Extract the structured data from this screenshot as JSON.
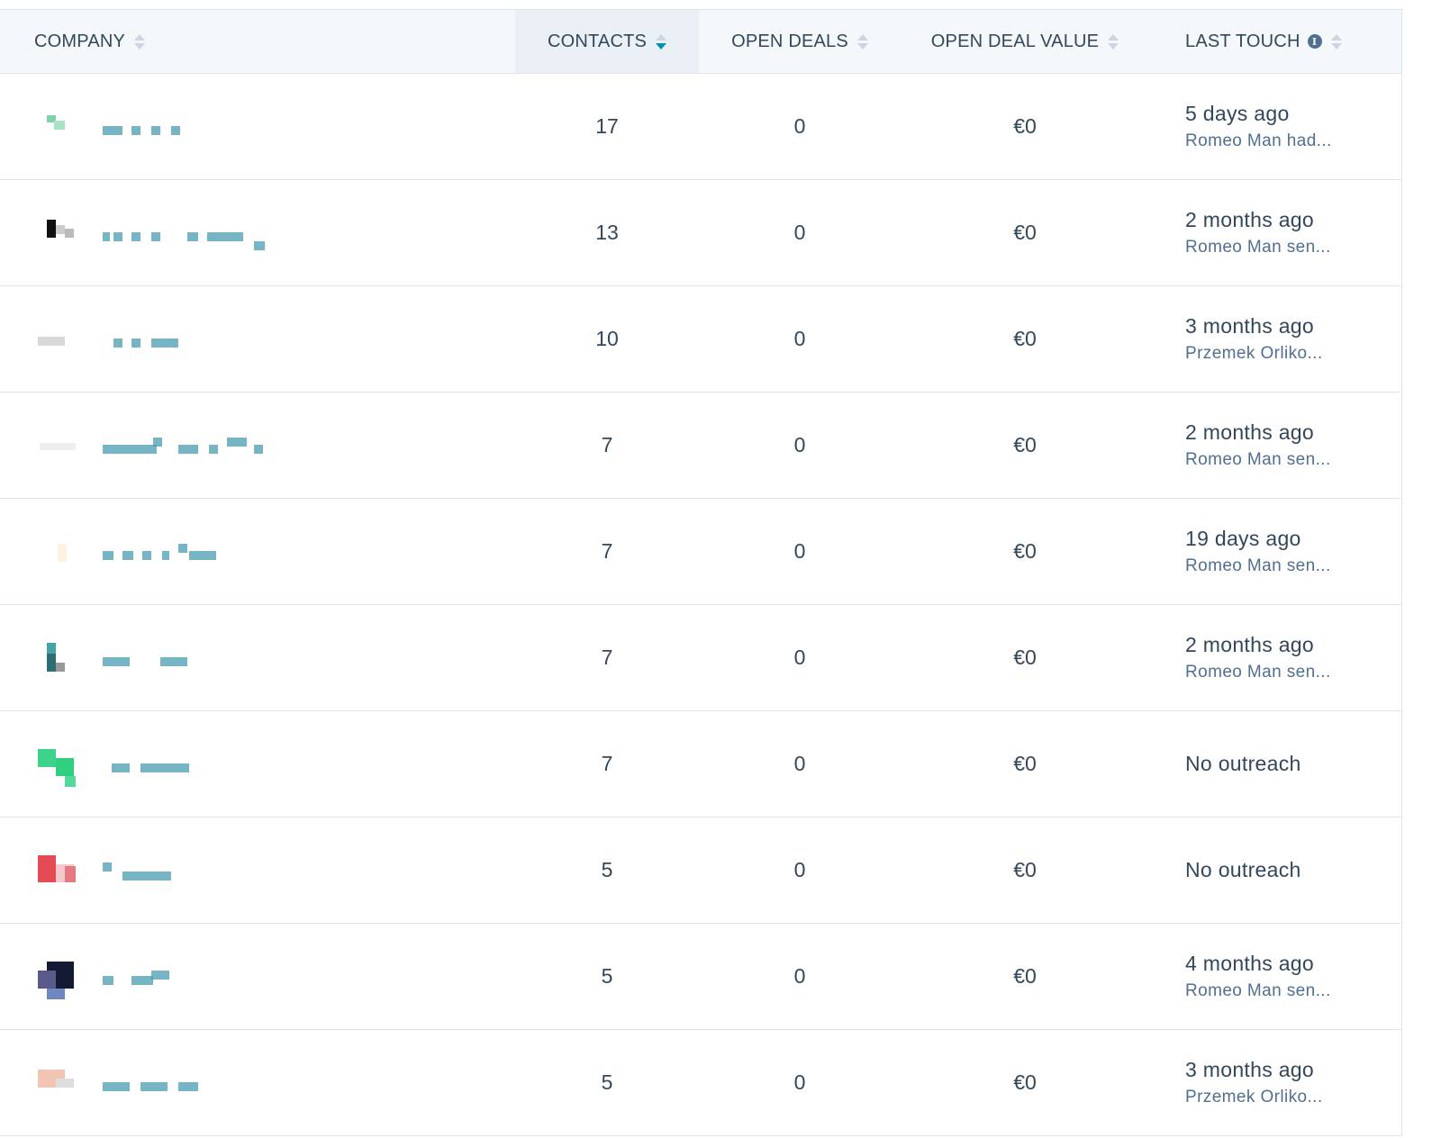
{
  "columns": {
    "company": "COMPANY",
    "contacts": "CONTACTS",
    "open_deals": "OPEN DEALS",
    "open_deal_value": "OPEN DEAL VALUE",
    "last_touch": "LAST TOUCH"
  },
  "sort": {
    "column": "contacts",
    "direction": "descending"
  },
  "icons": {
    "sort": "sort-arrows-icon",
    "info": "info-icon",
    "logo": "company-logo-icon"
  },
  "colors": {
    "accent": "#0091ae",
    "header_bg": "#f5f8fa",
    "border": "#dfe3eb",
    "text": "#33475b",
    "subtext": "#516f90"
  },
  "rows": [
    {
      "contacts": "17",
      "open_deals": "0",
      "open_deal_value": "€0",
      "last_touch": "5 days ago",
      "last_touch_detail": "Romeo Man had..."
    },
    {
      "contacts": "13",
      "open_deals": "0",
      "open_deal_value": "€0",
      "last_touch": "2 months ago",
      "last_touch_detail": "Romeo Man sen..."
    },
    {
      "contacts": "10",
      "open_deals": "0",
      "open_deal_value": "€0",
      "last_touch": "3 months ago",
      "last_touch_detail": "Przemek Orliko..."
    },
    {
      "contacts": "7",
      "open_deals": "0",
      "open_deal_value": "€0",
      "last_touch": "2 months ago",
      "last_touch_detail": "Romeo Man sen..."
    },
    {
      "contacts": "7",
      "open_deals": "0",
      "open_deal_value": "€0",
      "last_touch": "19 days ago",
      "last_touch_detail": "Romeo Man sen..."
    },
    {
      "contacts": "7",
      "open_deals": "0",
      "open_deal_value": "€0",
      "last_touch": "2 months ago",
      "last_touch_detail": "Romeo Man sen..."
    },
    {
      "contacts": "7",
      "open_deals": "0",
      "open_deal_value": "€0",
      "last_touch": "No outreach",
      "last_touch_detail": ""
    },
    {
      "contacts": "5",
      "open_deals": "0",
      "open_deal_value": "€0",
      "last_touch": "No outreach",
      "last_touch_detail": ""
    },
    {
      "contacts": "5",
      "open_deals": "0",
      "open_deal_value": "€0",
      "last_touch": "4 months ago",
      "last_touch_detail": "Romeo Man sen..."
    },
    {
      "contacts": "5",
      "open_deals": "0",
      "open_deal_value": "€0",
      "last_touch": "3 months ago",
      "last_touch_detail": "Przemek Orliko..."
    }
  ]
}
